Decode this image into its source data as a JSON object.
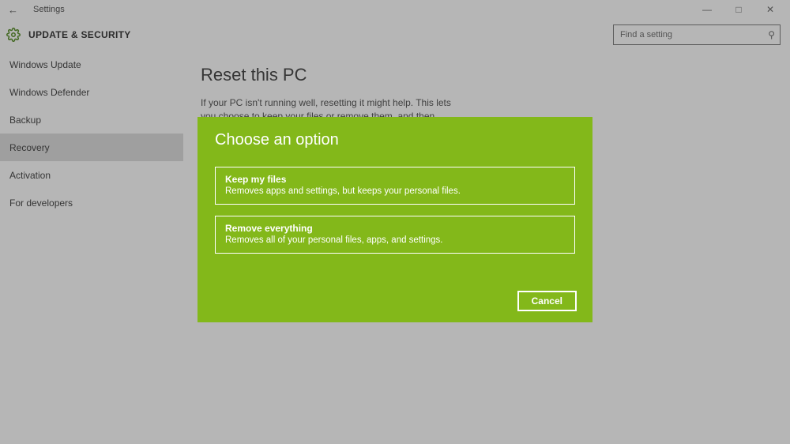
{
  "window": {
    "title": "Settings"
  },
  "header": {
    "section": "UPDATE & SECURITY",
    "search_placeholder": "Find a setting"
  },
  "sidebar": {
    "items": [
      "Windows Update",
      "Windows Defender",
      "Backup",
      "Recovery",
      "Activation",
      "For developers"
    ],
    "selected_index": 3
  },
  "main": {
    "title": "Reset this PC",
    "description": "If your PC isn't running well, resetting it might help. This lets you choose to keep your files or remove them, and then reinstalls Windows."
  },
  "modal": {
    "title": "Choose an option",
    "options": [
      {
        "title": "Keep my files",
        "description": "Removes apps and settings, but keeps your personal files."
      },
      {
        "title": "Remove everything",
        "description": "Removes all of your personal files, apps, and settings."
      }
    ],
    "cancel_label": "Cancel"
  },
  "colors": {
    "accent_green": "#83b81a",
    "sidebar_selected": "#d8d8d8"
  }
}
